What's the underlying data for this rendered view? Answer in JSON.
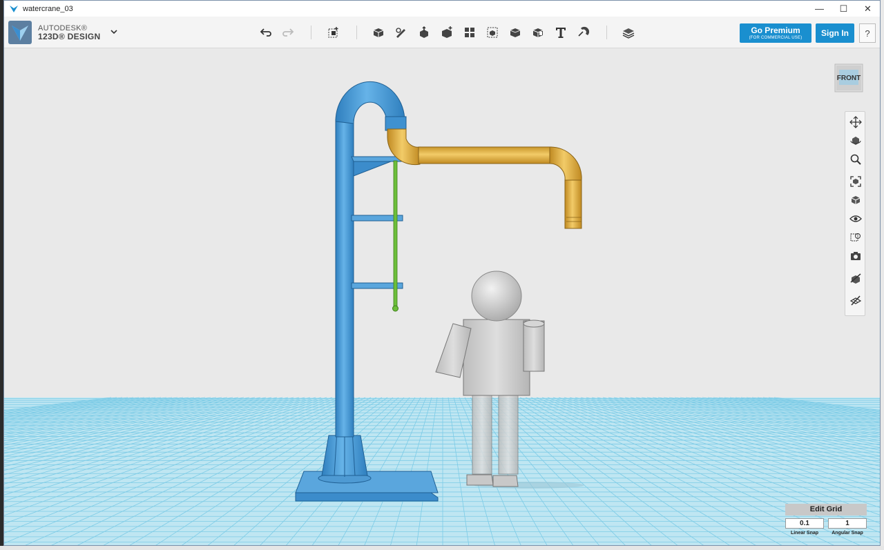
{
  "window": {
    "title": "watercrane_03",
    "min_glyph": "—",
    "max_glyph": "☐",
    "close_glyph": "✕"
  },
  "logo": {
    "line1": "AUTODESK®",
    "line2": "123D® DESIGN"
  },
  "toolbar": {
    "icons": [
      "undo-icon",
      "redo-icon",
      "transform-icon",
      "primitives-icon",
      "sketch-icon",
      "construct-icon",
      "modify-icon",
      "pattern-icon",
      "grouping-icon",
      "combine-icon",
      "measure-icon",
      "text-icon",
      "snap-icon",
      "material-icon"
    ]
  },
  "account": {
    "go_premium": "Go Premium",
    "go_premium_sub": "(FOR COMMERCIAL USE)",
    "sign_in": "Sign In",
    "help": "?"
  },
  "viewcube": {
    "label": "FRONT"
  },
  "nav_panel": {
    "icons": [
      "pan-icon",
      "orbit-icon",
      "zoom-icon",
      "fit-icon",
      "views-icon",
      "visibility-icon",
      "materials-outline-icon",
      "camera-icon",
      "grid-snap-icon",
      "edit-grid-icon"
    ]
  },
  "grid": {
    "title": "Edit Grid",
    "linear_snap_value": "0.1",
    "angular_snap_value": "1",
    "linear_snap_label": "Linear Snap",
    "angular_snap_label": "Angular Snap"
  },
  "colors": {
    "crane_blue": "#4a9bd6",
    "spout_yellow": "#e8b94a",
    "rod_green": "#6cbf3a",
    "figure_grey": "#c9c9c9",
    "accent": "#1a8fcf"
  }
}
